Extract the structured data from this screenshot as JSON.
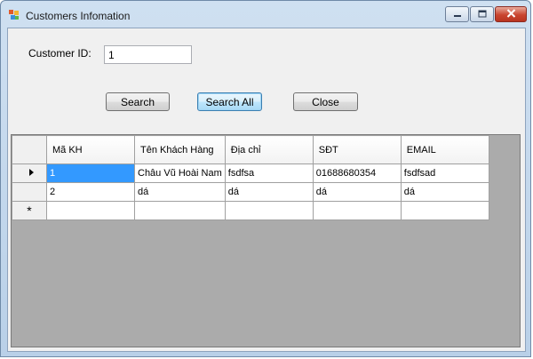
{
  "window": {
    "title": "Customers Infomation",
    "controls": [
      "minimize-icon",
      "maximize-icon",
      "close-icon"
    ]
  },
  "form": {
    "customer_id_label": "Customer ID:",
    "customer_id_value": "1",
    "search_label": "Search",
    "search_all_label": "Search All",
    "close_label": "Close"
  },
  "grid": {
    "columns": [
      "Mã KH",
      "Tên Khách Hàng",
      "Địa chỉ",
      "SĐT",
      "EMAIL"
    ],
    "rows": [
      [
        "1",
        "Châu Vũ Hoài Nam",
        "fsdfsa",
        "01688680354",
        "fsdfsad"
      ],
      [
        "2",
        "dá",
        "dá",
        "dá",
        "dá"
      ]
    ],
    "new_row_marker": "*",
    "colors": {
      "selected_cell": "#3399ff",
      "grid_background": "#ababab"
    }
  }
}
